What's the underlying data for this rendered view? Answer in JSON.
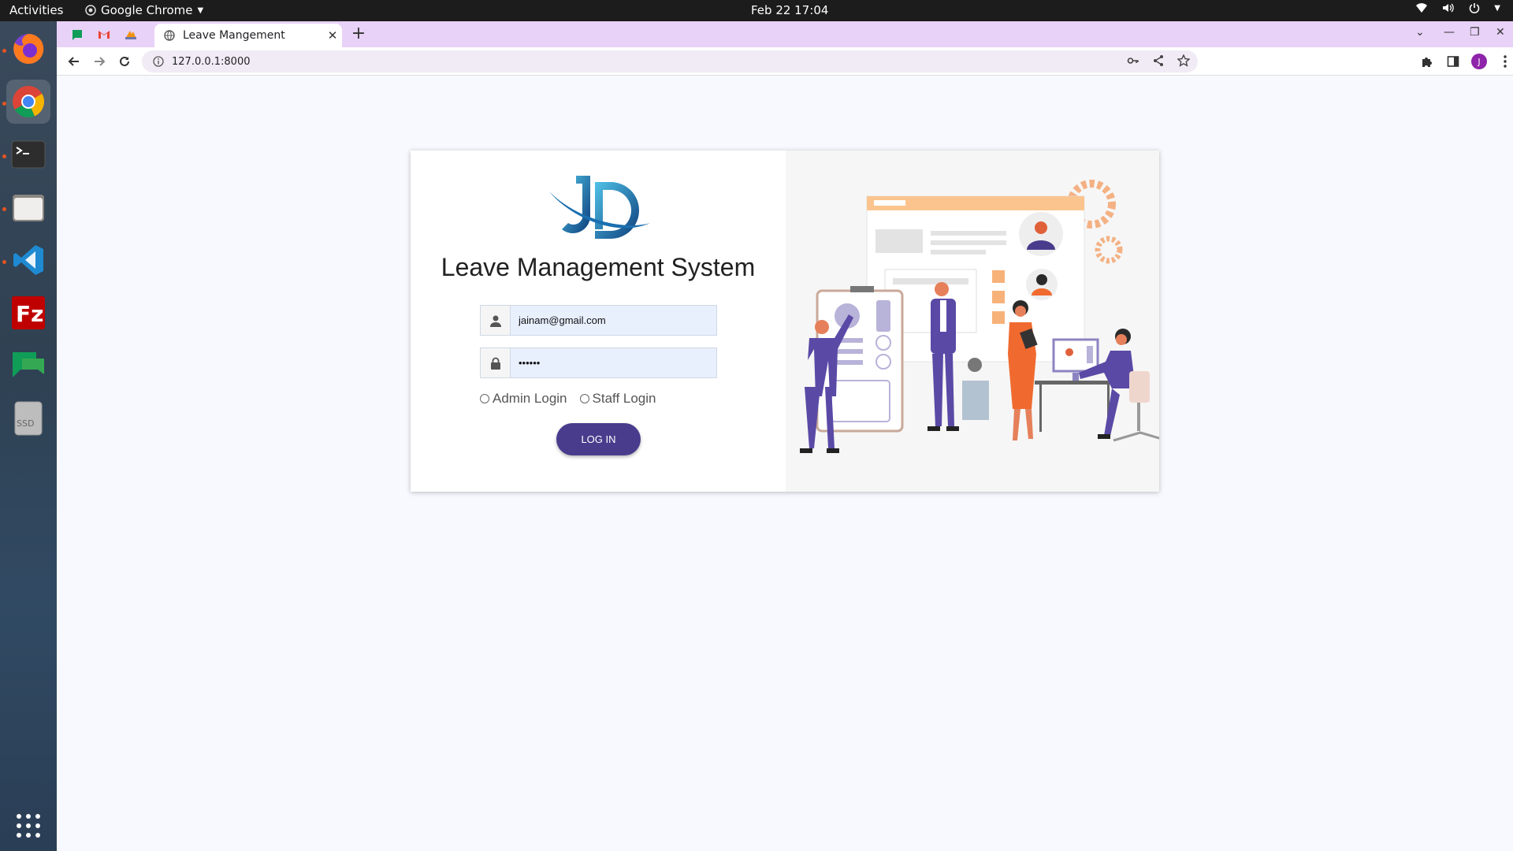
{
  "topbar": {
    "activities": "Activities",
    "app_name": "Google Chrome",
    "clock": "Feb 22  17:04"
  },
  "dock": {
    "items": [
      "firefox-icon",
      "chrome-icon",
      "terminal-icon",
      "files-icon",
      "vscode-icon",
      "filezilla-icon",
      "chat-icon",
      "ssd-icon"
    ],
    "ssd_label": "SSD"
  },
  "browser": {
    "tab_title": "Leave Mangement",
    "url": "127.0.0.1:8000",
    "profile_initial": "J"
  },
  "page": {
    "logo_text": "JD",
    "title": "Leave Management System",
    "email_value": "jainam@gmail.com",
    "password_value": "••••••",
    "radio_admin": "Admin Login",
    "radio_staff": "Staff Login",
    "login_button": "LOG IN"
  },
  "colors": {
    "accent": "#4a3c8c",
    "tabstrip": "#e8d2f7",
    "illustration_primary": "#5a4aa6",
    "illustration_secondary": "#f06a2f"
  }
}
